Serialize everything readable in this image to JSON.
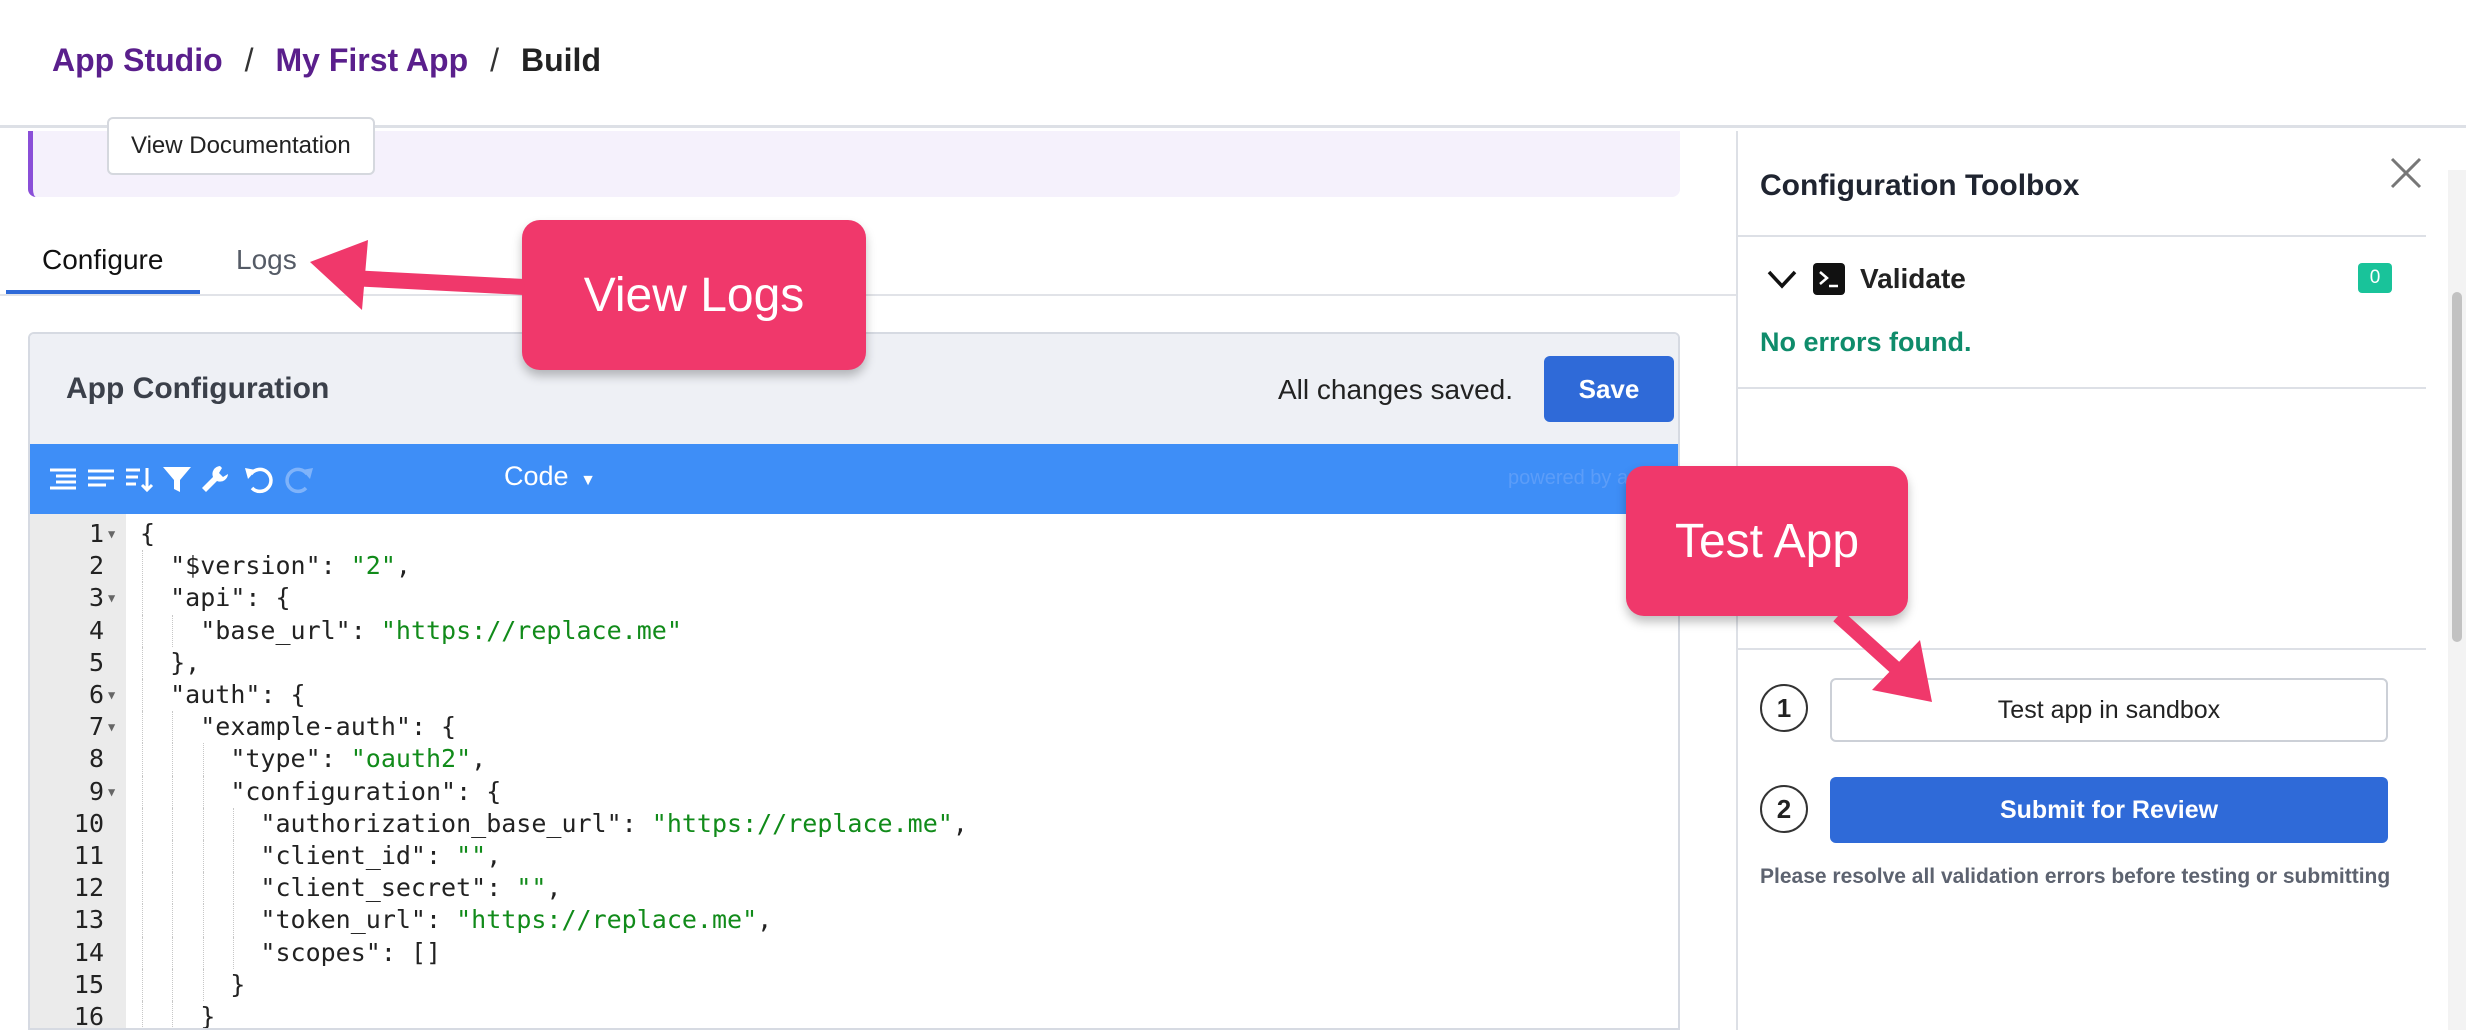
{
  "breadcrumb": {
    "root": "App Studio",
    "app": "My First App",
    "current": "Build",
    "separator": "/"
  },
  "banner": {
    "doc_button": "View Documentation"
  },
  "tabs": {
    "configure": "Configure",
    "logs": "Logs"
  },
  "config_card": {
    "title": "App Configuration",
    "status": "All changes saved.",
    "save_label": "Save",
    "mode": "Code",
    "powered_by": "powered by ace"
  },
  "editor": {
    "lines": [
      "{",
      "  \"$version\": \"2\",",
      "  \"api\": {",
      "    \"base_url\": \"https://replace.me\"",
      "  },",
      "  \"auth\": {",
      "    \"example-auth\": {",
      "      \"type\": \"oauth2\",",
      "      \"configuration\": {",
      "        \"authorization_base_url\": \"https://replace.me\",",
      "        \"client_id\": \"\",",
      "        \"client_secret\": \"\",",
      "        \"token_url\": \"https://replace.me\",",
      "        \"scopes\": []",
      "      }",
      "    }",
      "  }"
    ],
    "foldable_lines": [
      1,
      3,
      6,
      7,
      9
    ]
  },
  "toolbox": {
    "title": "Configuration Toolbox",
    "validate_label": "Validate",
    "error_count": "0",
    "no_errors": "No errors found.",
    "step1_number": "1",
    "step2_number": "2",
    "sandbox_button": "Test app in sandbox",
    "review_button": "Submit for Review",
    "hint": "Please resolve all validation errors before testing or submitting"
  },
  "annotations": {
    "view_logs": "View Logs",
    "test_app": "Test App"
  },
  "colors": {
    "accent_blue": "#2f6ad8",
    "toolbar_blue": "#3e8ef7",
    "breadcrumb_purple": "#5a1f8c",
    "callout_pink": "#f0386b",
    "success_green": "#0f8c6b",
    "string_green": "#118b1a"
  }
}
